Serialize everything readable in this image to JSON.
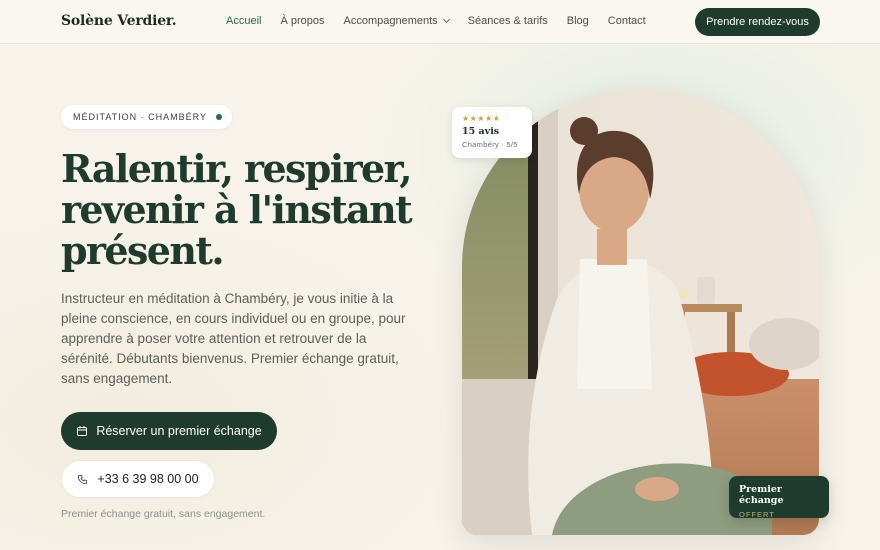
{
  "brand": {
    "logo": "Solène Verdier."
  },
  "nav": {
    "links": [
      "Accueil",
      "À propos",
      "Accompagnements",
      "Séances & tarifs",
      "Blog",
      "Contact"
    ],
    "active": "Accueil",
    "cta": "Prendre rendez-vous"
  },
  "hero": {
    "badge": "MÉDITATION · CHAMBÉRY",
    "headline": "Ralentir, respirer, revenir à l'instant présent.",
    "lead": "Instructeur en méditation à Chambéry, je vous initie à la pleine conscience, en cours individuel ou en groupe, pour apprendre à poser votre attention et retrouver de la sérénité. Débutants bienvenus. Premier échange gratuit, sans engagement.",
    "primary_cta": "Réserver un premier échange",
    "phone": "+33 6 39 98 00 00",
    "note": "Premier échange gratuit, sans engagement."
  },
  "rating_card": {
    "stars": "★★★★★",
    "count": "15 avis",
    "location": "Chambéry · 5/5"
  },
  "offer_card": {
    "title": "Premier échange",
    "subtitle": "OFFERT"
  },
  "colors": {
    "accent": "#1f3b2e",
    "active_link": "#2c6a4e",
    "background": "#f7f3ea",
    "star": "#c9a24a"
  },
  "icons": [
    "calendar-icon",
    "phone-icon",
    "chevron-down-icon",
    "status-dot"
  ]
}
